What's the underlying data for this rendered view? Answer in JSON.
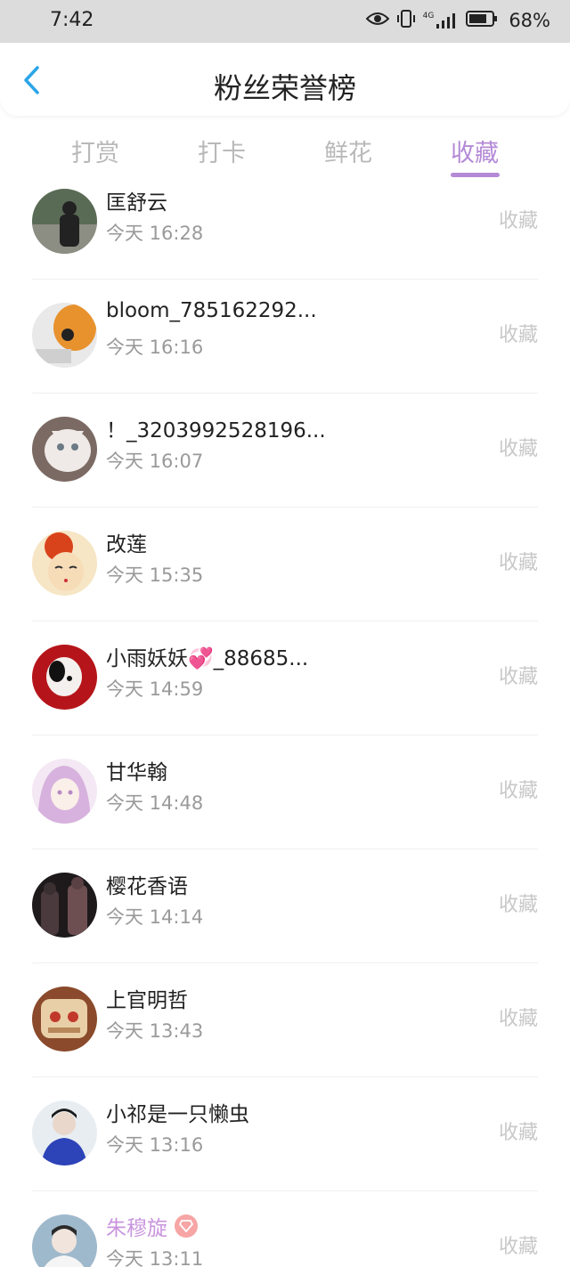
{
  "status": {
    "time": "7:42",
    "battery": "68%",
    "net_label": "4G"
  },
  "header": {
    "title": "粉丝荣誉榜"
  },
  "tabs": [
    {
      "label": "打赏"
    },
    {
      "label": "打卡"
    },
    {
      "label": "鲜花"
    },
    {
      "label": "收藏"
    }
  ],
  "rows": [
    {
      "name": "匡舒云",
      "time": "今天 16:28",
      "action": "收藏",
      "avatar_colors": [
        "#5a6b55",
        "#222"
      ]
    },
    {
      "name": "bloom_785162292...",
      "time": "今天 16:16",
      "action": "收藏",
      "avatar_colors": [
        "#e8922e",
        "#e9e9e9"
      ]
    },
    {
      "name": "！_3203992528196...",
      "time": "今天 16:07",
      "action": "收藏",
      "avatar_colors": [
        "#d7cfcc",
        "#7b6a63"
      ]
    },
    {
      "name": "改莲",
      "time": "今天 15:35",
      "action": "收藏",
      "avatar_colors": [
        "#f6d8a8",
        "#d9431c"
      ]
    },
    {
      "name": "小雨妖妖💞_88685...",
      "time": "今天 14:59",
      "action": "收藏",
      "avatar_colors": [
        "#b5151a",
        "#ffffff"
      ]
    },
    {
      "name": "甘华翰",
      "time": "今天 14:48",
      "action": "收藏",
      "avatar_colors": [
        "#e9d3ec",
        "#b78ac3"
      ]
    },
    {
      "name": "樱花香语",
      "time": "今天 14:14",
      "action": "收藏",
      "avatar_colors": [
        "#2a2225",
        "#6d4f52"
      ]
    },
    {
      "name": "上官明哲",
      "time": "今天 13:43",
      "action": "收藏",
      "avatar_colors": [
        "#d4a77c",
        "#8a4a2b"
      ]
    },
    {
      "name": "小祁是一只懒虫",
      "time": "今天 13:16",
      "action": "收藏",
      "avatar_colors": [
        "#2d43b8",
        "#e9d7cb"
      ]
    },
    {
      "name": "朱穆旋",
      "time": "今天 13:11",
      "action": "收藏",
      "avatar_colors": [
        "#9fb9cc",
        "#f0e4dc"
      ],
      "vip": true
    }
  ]
}
